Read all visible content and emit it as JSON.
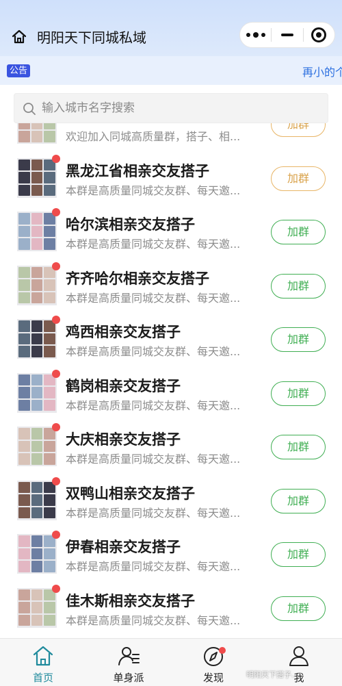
{
  "header": {
    "title": "明阳天下同城私域"
  },
  "notice": {
    "badge": "公告",
    "text": "再小的个"
  },
  "search": {
    "placeholder": "输入城市名字搜索"
  },
  "groups": [
    {
      "name": "",
      "desc": "欢迎加入同城高质量群，搭子、相...",
      "join": "加群",
      "style": "orange"
    },
    {
      "name": "黑龙江省相亲交友搭子",
      "desc": "本群是高质量同城交友群、每天邀...",
      "join": "加群",
      "style": "orange"
    },
    {
      "name": "哈尔滨相亲交友搭子",
      "desc": "本群是高质量同城交友群、每天邀...",
      "join": "加群",
      "style": "green"
    },
    {
      "name": "齐齐哈尔相亲交友搭子",
      "desc": "本群是高质量同城交友群、每天邀...",
      "join": "加群",
      "style": "green"
    },
    {
      "name": "鸡西相亲交友搭子",
      "desc": "本群是高质量同城交友群、每天邀...",
      "join": "加群",
      "style": "green"
    },
    {
      "name": "鹤岗相亲交友搭子",
      "desc": "本群是高质量同城交友群、每天邀...",
      "join": "加群",
      "style": "green"
    },
    {
      "name": "大庆相亲交友搭子",
      "desc": "本群是高质量同城交友群、每天邀...",
      "join": "加群",
      "style": "green"
    },
    {
      "name": "双鸭山相亲交友搭子",
      "desc": "本群是高质量同城交友群、每天邀...",
      "join": "加群",
      "style": "green"
    },
    {
      "name": "伊春相亲交友搭子",
      "desc": "本群是高质量同城交友群、每天邀...",
      "join": "加群",
      "style": "green"
    },
    {
      "name": "佳木斯相亲交友搭子",
      "desc": "本群是高质量同城交友群、每天邀...",
      "join": "加群",
      "style": "green"
    }
  ],
  "tabbar": {
    "tabs": [
      {
        "label": "首页",
        "icon": "home-icon",
        "active": true
      },
      {
        "label": "单身派",
        "icon": "user-list-icon",
        "active": false
      },
      {
        "label": "发现",
        "icon": "compass-icon",
        "active": false
      },
      {
        "label": "我",
        "icon": "person-icon",
        "active": false
      }
    ]
  },
  "watermark": "明阳天下搭子...",
  "colors": {
    "accent_teal": "#1f8a9c",
    "join_green": "#3fae52",
    "join_orange": "#d9a24a",
    "badge_blue": "#3a54e0",
    "red_dot": "#ef4b4b"
  }
}
